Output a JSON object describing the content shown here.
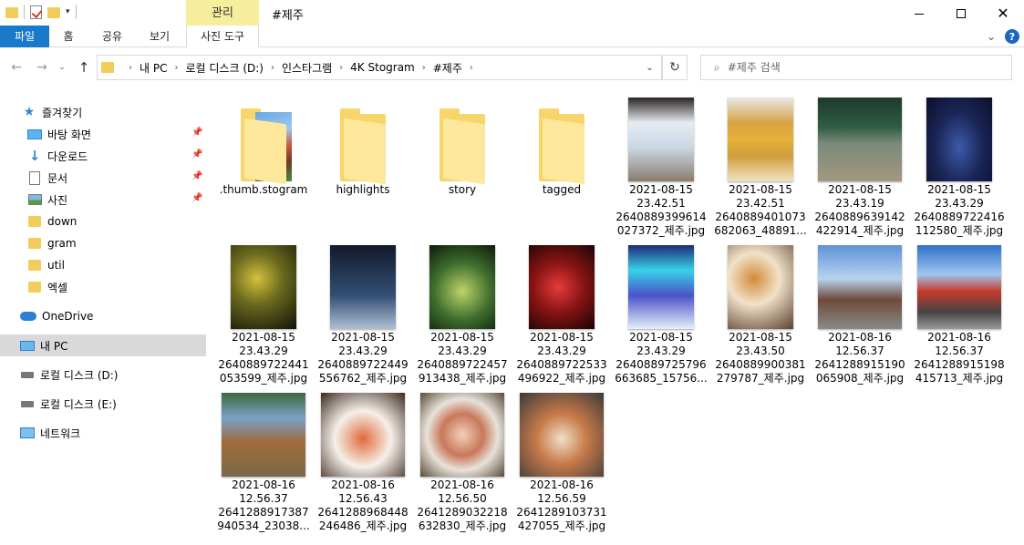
{
  "window": {
    "title": "#제주",
    "context_tab": "관리",
    "controls": {
      "minimize": "─",
      "maximize": "□",
      "close": "✕"
    }
  },
  "ribbon": {
    "tabs": [
      "파일",
      "홈",
      "공유",
      "보기",
      "사진 도구"
    ],
    "accent": "#1979ca",
    "context_color": "#f7ee9d"
  },
  "address": {
    "breadcrumbs": [
      "내 PC",
      "로컬 디스크 (D:)",
      "인스타그램",
      "4K Stogram",
      "#제주"
    ]
  },
  "search": {
    "placeholder": "#제주 검색"
  },
  "sidebar": {
    "items": [
      {
        "label": "즐겨찾기",
        "icon": "star-icon"
      },
      {
        "label": "바탕 화면",
        "icon": "desktop-icon",
        "pinned": true
      },
      {
        "label": "다운로드",
        "icon": "download-icon",
        "pinned": true
      },
      {
        "label": "문서",
        "icon": "document-icon",
        "pinned": true
      },
      {
        "label": "사진",
        "icon": "pictures-icon",
        "pinned": true
      },
      {
        "label": "down",
        "icon": "folder-icon"
      },
      {
        "label": "gram",
        "icon": "folder-icon"
      },
      {
        "label": "util",
        "icon": "folder-icon"
      },
      {
        "label": "엑셀",
        "icon": "folder-icon"
      },
      {
        "label": "OneDrive",
        "icon": "onedrive-icon"
      },
      {
        "label": "내 PC",
        "icon": "pc-icon",
        "selected": true
      },
      {
        "label": "로컬 디스크 (D:)",
        "icon": "drive-icon"
      },
      {
        "label": "로컬 디스크 (E:)",
        "icon": "drive-icon"
      },
      {
        "label": "네트워크",
        "icon": "network-icon"
      }
    ]
  },
  "files": [
    {
      "kind": "folder-thumb",
      "lines": [
        ".thumb.stogram"
      ]
    },
    {
      "kind": "folder",
      "lines": [
        "highlights"
      ]
    },
    {
      "kind": "folder",
      "lines": [
        "story"
      ]
    },
    {
      "kind": "folder",
      "lines": [
        "tagged"
      ]
    },
    {
      "kind": "photo",
      "style": "ph-room",
      "lines": [
        "2021-08-15",
        "23.42.51",
        "2640889399614",
        "027372_제주.jpg"
      ]
    },
    {
      "kind": "photo",
      "style": "ph-beer",
      "lines": [
        "2021-08-15",
        "23.42.51",
        "2640889401073",
        "682063_48891..."
      ]
    },
    {
      "kind": "photo-land",
      "style": "ph-bar",
      "lines": [
        "2021-08-15",
        "23.43.19",
        "2640889639142",
        "422914_제주.jpg"
      ]
    },
    {
      "kind": "photo",
      "style": "ph-space1",
      "lines": [
        "2021-08-15",
        "23.43.29",
        "2640889722416",
        "112580_제주.jpg"
      ]
    },
    {
      "kind": "photo",
      "style": "ph-gold",
      "lines": [
        "2021-08-15",
        "23.43.29",
        "2640889722441",
        "053599_제주.jpg"
      ]
    },
    {
      "kind": "photo",
      "style": "ph-wave",
      "lines": [
        "2021-08-15",
        "23.43.29",
        "2640889722449",
        "556762_제주.jpg"
      ]
    },
    {
      "kind": "photo",
      "style": "ph-garden",
      "lines": [
        "2021-08-15",
        "23.43.29",
        "2640889722457",
        "913438_제주.jpg"
      ]
    },
    {
      "kind": "photo",
      "style": "ph-red",
      "lines": [
        "2021-08-15",
        "23.43.29",
        "2640889722533",
        "496922_제주.jpg"
      ]
    },
    {
      "kind": "photo",
      "style": "ph-aurora",
      "lines": [
        "2021-08-15",
        "23.43.29",
        "2640889725796",
        "663685_15756..."
      ]
    },
    {
      "kind": "photo",
      "style": "ph-food1",
      "lines": [
        "2021-08-15",
        "23.43.50",
        "2640889900381",
        "279787_제주.jpg"
      ]
    },
    {
      "kind": "photo-land",
      "style": "ph-house1",
      "lines": [
        "2021-08-16",
        "12.56.37",
        "2641288915190",
        "065908_제주.jpg"
      ]
    },
    {
      "kind": "photo-land",
      "style": "ph-house2",
      "lines": [
        "2021-08-16",
        "12.56.37",
        "2641288915198",
        "415713_제주.jpg"
      ]
    },
    {
      "kind": "photo-land",
      "style": "ph-arch",
      "lines": [
        "2021-08-16",
        "12.56.37",
        "2641288917387",
        "940534_23038..."
      ]
    },
    {
      "kind": "photo-land",
      "style": "ph-bowl",
      "lines": [
        "2021-08-16",
        "12.56.43",
        "2641288968448",
        "246486_제주.jpg"
      ]
    },
    {
      "kind": "photo-land",
      "style": "ph-table",
      "lines": [
        "2021-08-16",
        "12.56.50",
        "2641289032218",
        "632830_제주.jpg"
      ]
    },
    {
      "kind": "photo-land",
      "style": "ph-sushi",
      "lines": [
        "2021-08-16",
        "12.56.59",
        "2641289103731",
        "427055_제주.jpg"
      ]
    }
  ]
}
